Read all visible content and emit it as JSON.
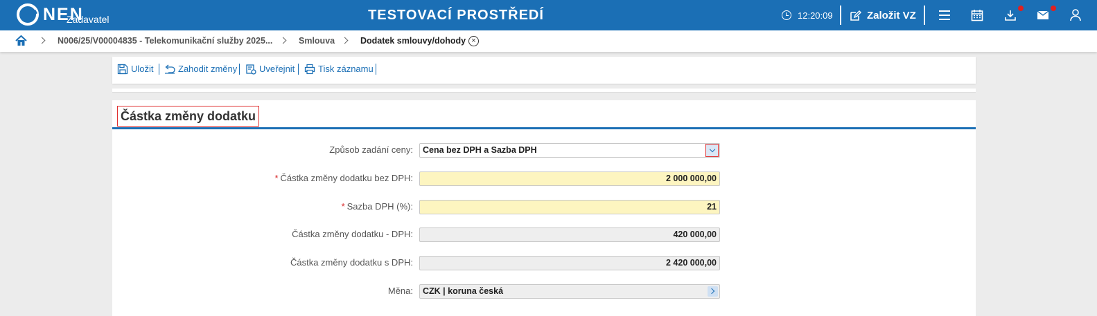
{
  "header": {
    "logo_text": "NEN",
    "logo_sub": "Zadavatel",
    "environment": "TESTOVACÍ PROSTŘEDÍ",
    "time": "12:20:09",
    "create_label": "Založit VZ",
    "icons": [
      "clock-icon",
      "edit-icon",
      "menu-icon",
      "calendar-icon",
      "download-icon",
      "mail-icon",
      "user-icon"
    ],
    "brand_color": "#1b6fb5",
    "notification_color": "#e0201f"
  },
  "breadcrumb": {
    "items": [
      "N006/25/V00004835 - Telekomunikační služby 2025...",
      "Smlouva",
      "Dodatek smlouvy/dohody"
    ]
  },
  "toolbar": {
    "save": "Uložit",
    "discard": "Zahodit změny",
    "publish": "Uveřejnit",
    "print": "Tisk záznamu"
  },
  "section": {
    "title": "Částka změny dodatku"
  },
  "form": {
    "price_mode": {
      "label": "Způsob zadání ceny:",
      "value": "Cena bez DPH a Sazba DPH"
    },
    "amount_no_vat": {
      "label": "Částka změny dodatku bez DPH:",
      "value": "2 000 000,00",
      "required": true
    },
    "vat_rate": {
      "label": "Sazba DPH (%):",
      "value": "21",
      "required": true
    },
    "vat_amount": {
      "label": "Částka změny dodatku - DPH:",
      "value": "420 000,00"
    },
    "amount_with_vat": {
      "label": "Částka změny dodatku s DPH:",
      "value": "2 420 000,00"
    },
    "currency": {
      "label": "Měna:",
      "value": "CZK | koruna česká"
    }
  }
}
